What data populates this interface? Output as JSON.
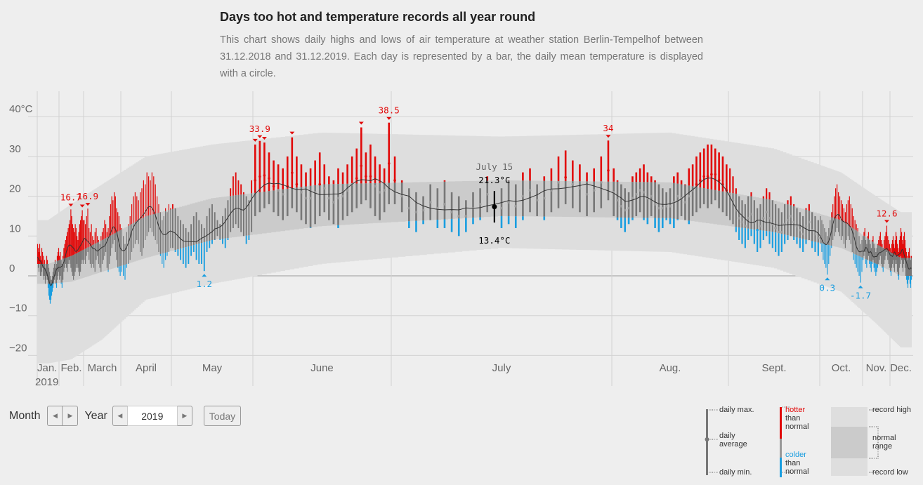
{
  "title": "Days too hot and temperature records all year round",
  "description": "This chart shows daily highs and lows of air temperature at weather station Berlin-Tempelhof between 31.12.2018 and 31.12.2019. Each day is represented by a bar, the daily mean temperature is displayed with a circle.",
  "controls": {
    "month_label": "Month",
    "year_label": "Year",
    "year_value": "2019",
    "today_label": "Today",
    "prev_icon": "triangle-left-icon",
    "next_icon": "triangle-right-icon"
  },
  "legend": {
    "daily_max": "daily max.",
    "daily_average_1": "daily",
    "daily_average_2": "average",
    "daily_min": "daily min.",
    "hotter": "hotter",
    "than_normal_1": "than",
    "than_normal_2": "normal",
    "colder": "colder",
    "than_normal_3": "than",
    "than_normal_4": "normal",
    "record_high": "record high",
    "normal_range_1": "normal",
    "normal_range_2": "range",
    "record_low": "record low"
  },
  "colors": {
    "hot": "#e10a0a",
    "cold": "#1a9ee0",
    "bar": "#777777",
    "normal_band": "#cbcbcb",
    "record_band": "#dedede",
    "mean_line": "#333333",
    "highlight": "#000000"
  },
  "chart_data": {
    "type": "bar",
    "y_unit": "°C",
    "ylim": [
      -20,
      45
    ],
    "y_ticks": [
      "40°C",
      "30",
      "20",
      "10",
      "0",
      "−10",
      "−20"
    ],
    "y_tick_values": [
      40,
      30,
      20,
      10,
      0,
      -10,
      -20
    ],
    "grid": true,
    "year_label": "2019",
    "months": [
      "Jan.",
      "Feb.",
      "March",
      "April",
      "May",
      "June",
      "July",
      "Aug.",
      "Sept.",
      "Oct.",
      "Nov.",
      "Dec."
    ],
    "normal_high": [
      3,
      5,
      9,
      15,
      19.5,
      23,
      24,
      23.5,
      19,
      14,
      8,
      4.5
    ],
    "normal_low": [
      -2,
      -1.5,
      1,
      4.5,
      9,
      12.5,
      15,
      14.5,
      11,
      7,
      3,
      0
    ],
    "record_high": [
      14,
      18,
      23,
      30,
      33,
      36,
      35,
      36,
      32,
      26,
      20,
      16
    ],
    "record_low": [
      -22,
      -21,
      -16,
      -6,
      -2,
      3,
      7,
      6,
      2,
      -4,
      -12,
      -18
    ],
    "tmax": [
      [
        8,
        7,
        6,
        8,
        5,
        4,
        7,
        6,
        5,
        3,
        4,
        2,
        3,
        5,
        4,
        3,
        2,
        1,
        0,
        -1,
        -1,
        0,
        1,
        2,
        3,
        4,
        2,
        3,
        5,
        6,
        7
      ],
      [
        5,
        6,
        4,
        3,
        5,
        7,
        8,
        9,
        10,
        11,
        12,
        13,
        14,
        16.7,
        15,
        13,
        12,
        11,
        13,
        12,
        10,
        9,
        11,
        13,
        14,
        15,
        16.5,
        14
      ],
      [
        14,
        13,
        15,
        16.9,
        12,
        11,
        13,
        10,
        9,
        11,
        12,
        10,
        9,
        8,
        10,
        11,
        12,
        14,
        13,
        11,
        12,
        15,
        18,
        20,
        19,
        21,
        20,
        17,
        16,
        15,
        13
      ],
      [
        12,
        10,
        8,
        11,
        13,
        15,
        18,
        20,
        21,
        20,
        19,
        21,
        22,
        24,
        23,
        26,
        25,
        24,
        26,
        25,
        23,
        20,
        18,
        16,
        14,
        15,
        17,
        16,
        18,
        17
      ],
      [
        18,
        17,
        15,
        14,
        13,
        12,
        11,
        13,
        15,
        16,
        14,
        13,
        12,
        15,
        17,
        18,
        16,
        14,
        13,
        15,
        17,
        19,
        22,
        25,
        26,
        24,
        23,
        21,
        20,
        19,
        24
      ],
      [
        33,
        33.9,
        33.5,
        31,
        29,
        28,
        27,
        30,
        34.8,
        30,
        28,
        26,
        27,
        29,
        31,
        28,
        25,
        24,
        27,
        26,
        28,
        30,
        32,
        37.3,
        31,
        33,
        30,
        28,
        27,
        38.5
      ],
      [
        30,
        24,
        22,
        21,
        20,
        23,
        22,
        24,
        21,
        20,
        19,
        21,
        22,
        25,
        21.3,
        22,
        24,
        23,
        26,
        27,
        23,
        25,
        27,
        30,
        31.5,
        29,
        28,
        26,
        27,
        30,
        34
      ],
      [
        27,
        24,
        23,
        22,
        21,
        25,
        26,
        27,
        28,
        26,
        25,
        24,
        23,
        22,
        21,
        22,
        25,
        26,
        24,
        23,
        27,
        28,
        30,
        31,
        32,
        33,
        33,
        32,
        31,
        30,
        28
      ],
      [
        27,
        25,
        22,
        20,
        19,
        18,
        20,
        21,
        19,
        17,
        18,
        20,
        22,
        21,
        19,
        18,
        17,
        16,
        18,
        19,
        20,
        18,
        17,
        16,
        15,
        17,
        18,
        16,
        15,
        14
      ],
      [
        15,
        14,
        13,
        12,
        11,
        10,
        12,
        14,
        16,
        18,
        20,
        22,
        23,
        21,
        20,
        19,
        18,
        17,
        16,
        18,
        19,
        20,
        18,
        17,
        15,
        14,
        13,
        12,
        10,
        8,
        9
      ],
      [
        10,
        11,
        12,
        9,
        8,
        10,
        11,
        9,
        8,
        7,
        9,
        10,
        8,
        7,
        6,
        7,
        8,
        9,
        10,
        11,
        9,
        8,
        7,
        9,
        10,
        11,
        12.6,
        10,
        9,
        8
      ],
      [
        7,
        6,
        8,
        9,
        10,
        8,
        7,
        9,
        11,
        10,
        8,
        7,
        6,
        9,
        10,
        12,
        11,
        9,
        8,
        10,
        11,
        9,
        7,
        6,
        5,
        4,
        6,
        7,
        5,
        4,
        5
      ]
    ],
    "tmin": [
      [
        3,
        2,
        1,
        3,
        0,
        0,
        1,
        2,
        0,
        -1,
        0,
        -2,
        -1,
        0,
        -1,
        -3,
        -5,
        -6,
        -7,
        -6,
        -5,
        -4,
        -3,
        -2,
        -1,
        0,
        -2,
        -3,
        -1,
        0,
        1
      ],
      [
        -1,
        0,
        -2,
        -3,
        -1,
        1,
        2,
        3,
        2,
        1,
        3,
        4,
        3,
        2,
        1,
        0,
        -1,
        0,
        1,
        2,
        3,
        2,
        1,
        0,
        1,
        3,
        4,
        3
      ],
      [
        4,
        3,
        5,
        6,
        4,
        3,
        2,
        3,
        2,
        1,
        4,
        5,
        3,
        2,
        1,
        3,
        4,
        5,
        6,
        2,
        1,
        3,
        5,
        7,
        8,
        9,
        6,
        4,
        2,
        1,
        0
      ],
      [
        1,
        0,
        -1,
        2,
        3,
        4,
        6,
        7,
        8,
        9,
        8,
        6,
        5,
        7,
        9,
        10,
        11,
        12,
        11,
        10,
        9,
        8,
        6,
        5,
        3,
        2,
        4,
        5,
        6,
        7
      ],
      [
        7,
        6,
        5,
        4,
        3,
        2,
        3,
        5,
        6,
        4,
        3,
        3,
        1.2,
        6,
        7,
        8,
        9,
        10,
        9,
        8,
        7,
        9,
        11,
        12,
        13,
        12,
        11,
        10,
        8,
        9,
        11
      ],
      [
        15,
        16,
        17,
        18,
        16,
        15,
        14,
        15,
        17,
        16,
        14,
        13,
        12,
        13,
        15,
        16,
        14,
        13,
        12,
        14,
        15,
        16,
        17,
        18,
        19,
        17,
        15,
        14,
        16,
        18
      ],
      [
        18,
        16,
        12,
        11,
        13,
        14,
        12,
        12,
        11,
        10,
        11,
        13,
        14,
        16,
        13.4,
        12,
        13,
        12,
        14,
        16,
        15,
        14,
        16,
        17,
        18,
        17,
        16,
        15,
        16,
        17,
        19
      ],
      [
        15,
        14,
        12,
        11,
        13,
        14,
        15,
        16,
        14,
        13,
        15,
        12,
        11,
        12,
        14,
        13,
        12,
        14,
        15,
        14,
        13,
        15,
        16,
        17,
        18,
        17,
        18,
        19,
        17,
        16,
        15
      ],
      [
        14,
        13,
        11,
        9,
        8,
        7,
        9,
        10,
        8,
        6,
        7,
        9,
        10,
        8,
        7,
        6,
        5,
        6,
        8,
        9,
        10,
        9,
        8,
        7,
        6,
        8,
        9,
        7,
        6,
        5
      ],
      [
        8,
        6,
        4,
        3,
        2,
        0.3,
        3,
        5,
        7,
        9,
        10,
        11,
        12,
        11,
        10,
        9,
        10,
        8,
        7,
        9,
        10,
        9,
        8,
        6,
        4,
        3,
        2,
        1,
        0,
        -1.7,
        1
      ],
      [
        4,
        5,
        6,
        3,
        2,
        4,
        5,
        3,
        2,
        1,
        3,
        4,
        2,
        1,
        0,
        1,
        2,
        3,
        4,
        5,
        3,
        2,
        1,
        3,
        4,
        5,
        6,
        4,
        3,
        2
      ],
      [
        1,
        0,
        2,
        3,
        4,
        2,
        1,
        3,
        4,
        3,
        1,
        0,
        -1,
        2,
        3,
        5,
        4,
        2,
        1,
        3,
        4,
        2,
        0,
        -1,
        -2,
        -3,
        -1,
        0,
        -2,
        -3,
        -1
      ]
    ],
    "records": [
      {
        "month": 2,
        "day": 14,
        "value": 16.7,
        "kind": "high",
        "label": "16.7"
      },
      {
        "month": 2,
        "day": 27,
        "value": 16.5,
        "kind": "high",
        "label": ""
      },
      {
        "month": 3,
        "day": 4,
        "value": 16.9,
        "kind": "high",
        "label": "16.9"
      },
      {
        "month": 5,
        "day": 13,
        "value": 1.2,
        "kind": "low",
        "label": "1.2"
      },
      {
        "month": 6,
        "day": 1,
        "value": 33,
        "kind": "high",
        "label": ""
      },
      {
        "month": 6,
        "day": 2,
        "value": 33.9,
        "kind": "high",
        "label": "33.9"
      },
      {
        "month": 6,
        "day": 3,
        "value": 33.5,
        "kind": "high",
        "label": ""
      },
      {
        "month": 6,
        "day": 9,
        "value": 34.8,
        "kind": "high",
        "label": ""
      },
      {
        "month": 6,
        "day": 24,
        "value": 37.3,
        "kind": "high",
        "label": ""
      },
      {
        "month": 6,
        "day": 30,
        "value": 38.5,
        "kind": "high",
        "label": "38.5"
      },
      {
        "month": 7,
        "day": 31,
        "value": 34,
        "kind": "high",
        "label": "34"
      },
      {
        "month": 10,
        "day": 6,
        "value": 0.3,
        "kind": "low",
        "label": "0.3"
      },
      {
        "month": 10,
        "day": 30,
        "value": -1.7,
        "kind": "low",
        "label": "-1.7"
      },
      {
        "month": 11,
        "day": 27,
        "value": 12.6,
        "kind": "high",
        "label": "12.6"
      }
    ],
    "highlight": {
      "month": 7,
      "day": 15,
      "date_label": "July 15",
      "max_label": "21.3°C",
      "min_label": "13.4°C"
    }
  }
}
